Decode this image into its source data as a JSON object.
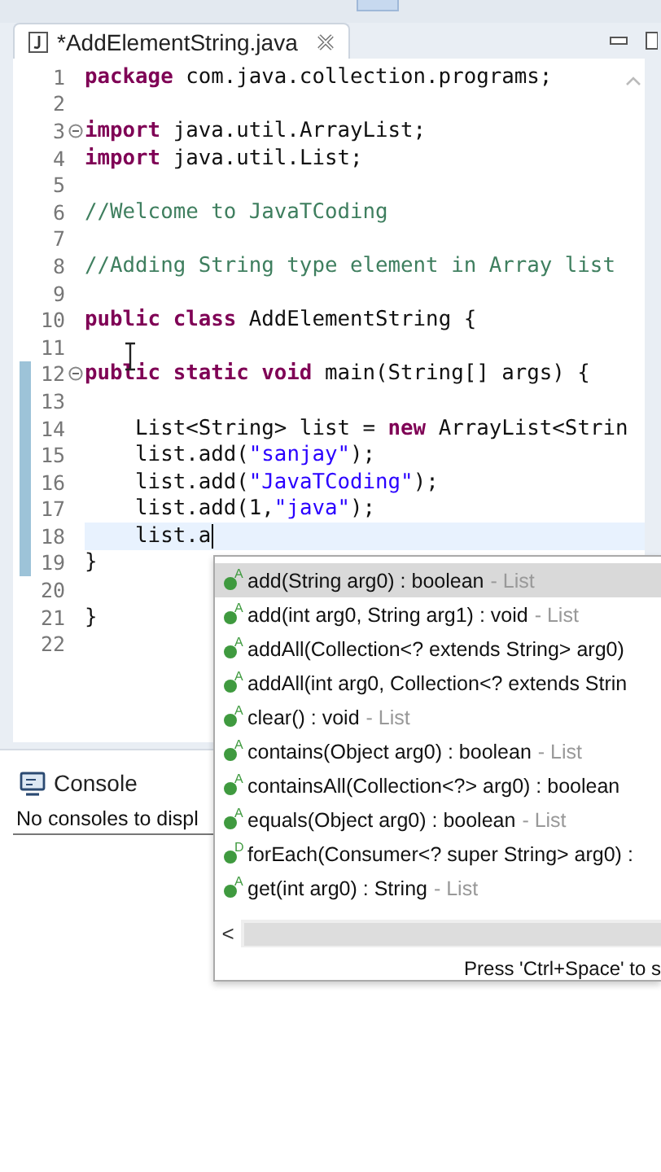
{
  "editor": {
    "tab": {
      "title": "*AddElementString.java"
    },
    "lines": [
      {
        "number": "1",
        "tokens": [
          {
            "text": "package",
            "kind": "keyword"
          },
          {
            "text": " com.java.collection.programs;",
            "kind": "plain"
          }
        ]
      },
      {
        "number": "2"
      },
      {
        "number": "3",
        "fold_marker": true,
        "tokens": [
          {
            "text": "import",
            "kind": "keyword"
          },
          {
            "text": " java.util.ArrayList;",
            "kind": "plain"
          }
        ]
      },
      {
        "number": "4",
        "tokens": [
          {
            "text": "import",
            "kind": "keyword"
          },
          {
            "text": " java.util.List;",
            "kind": "plain"
          }
        ]
      },
      {
        "number": "5"
      },
      {
        "number": "6",
        "tokens": [
          {
            "text": "//Welcome to JavaTCoding",
            "kind": "comment"
          }
        ]
      },
      {
        "number": "7"
      },
      {
        "number": "8",
        "tokens": [
          {
            "text": "//Adding String type element in Array list",
            "kind": "comment"
          }
        ]
      },
      {
        "number": "9"
      },
      {
        "number": "10",
        "tokens": [
          {
            "text": "public class",
            "kind": "keyword"
          },
          {
            "text": " AddElementString {",
            "kind": "plain"
          }
        ]
      },
      {
        "number": "11"
      },
      {
        "number": "12",
        "fold_marker": true,
        "changed": true,
        "tokens": [
          {
            "text": "public static void",
            "kind": "keyword"
          },
          {
            "text": " main(String[] args) {",
            "kind": "plain"
          }
        ]
      },
      {
        "number": "13",
        "changed": true
      },
      {
        "number": "14",
        "changed": true,
        "tokens": [
          {
            "text": "    List<String> list = ",
            "kind": "plain"
          },
          {
            "text": "new",
            "kind": "keyword"
          },
          {
            "text": " ArrayList<Strin",
            "kind": "plain"
          }
        ]
      },
      {
        "number": "15",
        "changed": true,
        "tokens": [
          {
            "text": "    list.add(",
            "kind": "plain"
          },
          {
            "text": "\"sanjay\"",
            "kind": "string"
          },
          {
            "text": ");",
            "kind": "plain"
          }
        ]
      },
      {
        "number": "16",
        "changed": true,
        "tokens": [
          {
            "text": "    list.add(",
            "kind": "plain"
          },
          {
            "text": "\"JavaTCoding\"",
            "kind": "string"
          },
          {
            "text": ");",
            "kind": "plain"
          }
        ]
      },
      {
        "number": "17",
        "changed": true,
        "tokens": [
          {
            "text": "    list.add(1,",
            "kind": "plain"
          },
          {
            "text": "\"java\"",
            "kind": "string"
          },
          {
            "text": ");",
            "kind": "plain"
          }
        ]
      },
      {
        "number": "18",
        "changed": true,
        "current": true,
        "tokens": [
          {
            "text": "    list.a",
            "kind": "plain"
          }
        ]
      },
      {
        "number": "19",
        "changed": true,
        "tokens": [
          {
            "text": "}",
            "kind": "plain"
          }
        ]
      },
      {
        "number": "20"
      },
      {
        "number": "21",
        "tokens": [
          {
            "text": "}",
            "kind": "plain"
          }
        ]
      },
      {
        "number": "22"
      }
    ]
  },
  "console": {
    "tab": "Console",
    "message": "No consoles to displ"
  },
  "completion": {
    "items": [
      {
        "badge": "A",
        "signature": "add(String arg0) : boolean",
        "owner": "- List",
        "selected": true
      },
      {
        "badge": "A",
        "signature": "add(int arg0, String arg1) : void",
        "owner": "- List",
        "selected": false
      },
      {
        "badge": "A",
        "signature": "addAll(Collection<? extends String> arg0)",
        "selected": false
      },
      {
        "badge": "A",
        "signature": "addAll(int arg0, Collection<? extends Strin",
        "selected": false
      },
      {
        "badge": "A",
        "signature": "clear() : void",
        "owner": "- List",
        "selected": false
      },
      {
        "badge": "A",
        "signature": "contains(Object arg0) : boolean",
        "owner": "- List",
        "selected": false
      },
      {
        "badge": "A",
        "signature": "containsAll(Collection<?> arg0) : boolean",
        "selected": false
      },
      {
        "badge": "A",
        "signature": "equals(Object arg0) : boolean",
        "owner": "- List",
        "selected": false
      },
      {
        "badge": "D",
        "signature": "forEach(Consumer<? super String> arg0) :",
        "selected": false
      },
      {
        "badge": "A",
        "signature": "get(int arg0) : String",
        "owner": "- List",
        "selected": false
      }
    ],
    "scroll_left": "<",
    "footer": "Press 'Ctrl+Space' to s"
  }
}
